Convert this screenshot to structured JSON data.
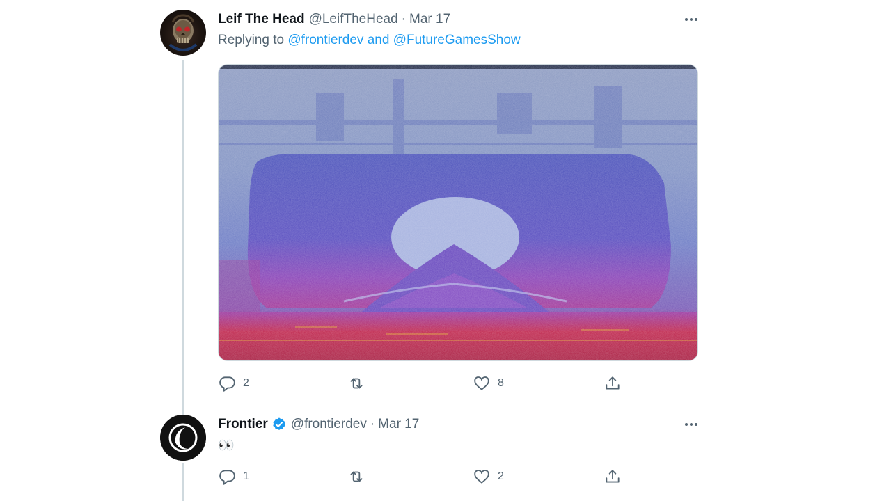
{
  "tweets": [
    {
      "display_name": "Leif The Head",
      "handle": "@LeifTheHead",
      "separator": "·",
      "date": "Mar 17",
      "avatar_icon": "skull-avatar",
      "replying_prefix": "Replying to",
      "replying_mention_1": "@frontierdev",
      "replying_conjunction": "and",
      "replying_mention_2": "@FutureGamesShow",
      "media_icon": "spectrogram-image",
      "reply_count": "2",
      "retweet_count": "",
      "like_count": "8"
    },
    {
      "display_name": "Frontier",
      "verified": true,
      "handle": "@frontierdev",
      "separator": "·",
      "date": "Mar 17",
      "avatar_icon": "frontier-logo",
      "text": "👀",
      "reply_count": "1",
      "retweet_count": "",
      "like_count": "2"
    }
  ],
  "colors": {
    "accent": "#1d9bf0",
    "secondary_text": "#536471",
    "thread_line": "#cfd9de"
  }
}
